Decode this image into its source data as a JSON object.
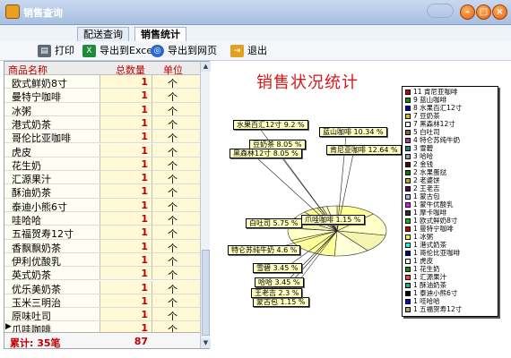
{
  "window": {
    "title": "销售查询"
  },
  "tabs": [
    {
      "label": "配送查询"
    },
    {
      "label": "销售统计"
    }
  ],
  "toolbar": {
    "print": "打印",
    "export_excel": "导出到Excel",
    "export_web": "导出到网页",
    "exit": "退出"
  },
  "grid": {
    "headers": {
      "name": "商品名称",
      "qty": "总数量",
      "unit": "单位"
    },
    "rows": [
      {
        "name": "欧式鲜奶8寸",
        "qty": "1",
        "unit": "个"
      },
      {
        "name": "曼特宁咖啡",
        "qty": "1",
        "unit": "个"
      },
      {
        "name": "冰粥",
        "qty": "1",
        "unit": "个"
      },
      {
        "name": "港式奶茶",
        "qty": "1",
        "unit": "个"
      },
      {
        "name": "哥伦比亚咖啡",
        "qty": "1",
        "unit": "个"
      },
      {
        "name": "虎皮",
        "qty": "1",
        "unit": "个"
      },
      {
        "name": "花生奶",
        "qty": "1",
        "unit": "个"
      },
      {
        "name": "汇源果汁",
        "qty": "1",
        "unit": "个"
      },
      {
        "name": "酥油奶茶",
        "qty": "1",
        "unit": "个"
      },
      {
        "name": "泰迪小熊6寸",
        "qty": "1",
        "unit": "个"
      },
      {
        "name": "哇哈哈",
        "qty": "1",
        "unit": "个"
      },
      {
        "name": "五福贺寿12寸",
        "qty": "1",
        "unit": "个"
      },
      {
        "name": "香飘飘奶茶",
        "qty": "1",
        "unit": "个"
      },
      {
        "name": "伊利优酸乳",
        "qty": "1",
        "unit": "个"
      },
      {
        "name": "英式奶茶",
        "qty": "1",
        "unit": "个"
      },
      {
        "name": "优乐美奶茶",
        "qty": "1",
        "unit": "个"
      },
      {
        "name": "玉米三明治",
        "qty": "1",
        "unit": "个"
      },
      {
        "name": "原味吐司",
        "qty": "1",
        "unit": "个"
      },
      {
        "name": "爪哇咖啡",
        "qty": "1",
        "unit": "个"
      }
    ],
    "total": {
      "label": "累计: 35笔",
      "qty": "87"
    }
  },
  "chart_data": {
    "type": "pie",
    "title": "销售状况统计",
    "slices": [
      {
        "label": "水果百汇12寸",
        "value": 9.2
      },
      {
        "label": "蓝山咖啡",
        "value": 10.34
      },
      {
        "label": "豆奶茶",
        "value": 8.05
      },
      {
        "label": "黑森林12寸",
        "value": 8.05
      },
      {
        "label": "肯尼亚咖啡",
        "value": 12.64
      },
      {
        "label": "白吐司",
        "value": 5.75
      },
      {
        "label": "特仑苏纯牛奶",
        "value": 4.6
      },
      {
        "label": "雪碧",
        "value": 3.45
      },
      {
        "label": "哈哈",
        "value": 3.45
      },
      {
        "label": "爪哇咖啡",
        "value": 1.15
      },
      {
        "label": "蒙古包",
        "value": 1.15
      },
      {
        "label": "王老吉",
        "value": 2.3
      }
    ],
    "legend": [
      {
        "count": "11",
        "name": "肯尼亚咖啡",
        "color": "#cc0000"
      },
      {
        "count": "9",
        "name": "蓝山咖啡",
        "color": "#00a000"
      },
      {
        "count": "8",
        "name": "水果百汇12寸",
        "color": "#0000cc"
      },
      {
        "count": "7",
        "name": "豆奶茶",
        "color": "#e0c000"
      },
      {
        "count": "7",
        "name": "黑森林12寸",
        "color": "#ffffff"
      },
      {
        "count": "5",
        "name": "白吐司",
        "color": "#8a6a2a"
      },
      {
        "count": "4",
        "name": "特仑苏纯牛奶",
        "color": "#b030b0"
      },
      {
        "count": "3",
        "name": "雪碧",
        "color": "#009090"
      },
      {
        "count": "3",
        "name": "哈哈",
        "color": "#a0a0a0"
      },
      {
        "count": "2",
        "name": "金钱",
        "color": "#600000"
      },
      {
        "count": "2",
        "name": "水果蛋挞",
        "color": "#008000"
      },
      {
        "count": "2",
        "name": "老婆饼",
        "color": "#b0b000"
      },
      {
        "count": "2",
        "name": "王老吉",
        "color": "#600060"
      },
      {
        "count": "1",
        "name": "蒙古包",
        "color": "#a0c0ff"
      },
      {
        "count": "1",
        "name": "蒙牛优酸乳",
        "color": "#ff00ff"
      },
      {
        "count": "1",
        "name": "摩卡咖啡",
        "color": "#303030"
      },
      {
        "count": "1",
        "name": "欧式鲜奶8寸",
        "color": "#00c000"
      },
      {
        "count": "1",
        "name": "曼特宁咖啡",
        "color": "#cc0000"
      },
      {
        "count": "1",
        "name": "冰粥",
        "color": "#ffff00"
      },
      {
        "count": "1",
        "name": "港式奶茶",
        "color": "#00ffff"
      },
      {
        "count": "1",
        "name": "哥伦比亚咖啡",
        "color": "#000080"
      },
      {
        "count": "1",
        "name": "虎皮",
        "color": "#ffffff"
      },
      {
        "count": "1",
        "name": "花生奶",
        "color": "#00a000"
      },
      {
        "count": "1",
        "name": "汇源果汁",
        "color": "#ff4040"
      },
      {
        "count": "1",
        "name": "酥油奶茶",
        "color": "#00c080"
      },
      {
        "count": "1",
        "name": "泰迪小熊6寸",
        "color": "#000000"
      },
      {
        "count": "1",
        "name": "哇哈哈",
        "color": "#0000ff"
      },
      {
        "count": "1",
        "name": "五福贺寿12寸",
        "color": "#c0a060"
      }
    ]
  },
  "colors": {
    "accent_red": "#c00000",
    "title_red": "#d81818",
    "label_bg": "#ffffc0"
  },
  "icons": {
    "print": "printer-icon",
    "excel": "excel-icon",
    "web": "globe-icon",
    "exit": "exit-icon"
  }
}
